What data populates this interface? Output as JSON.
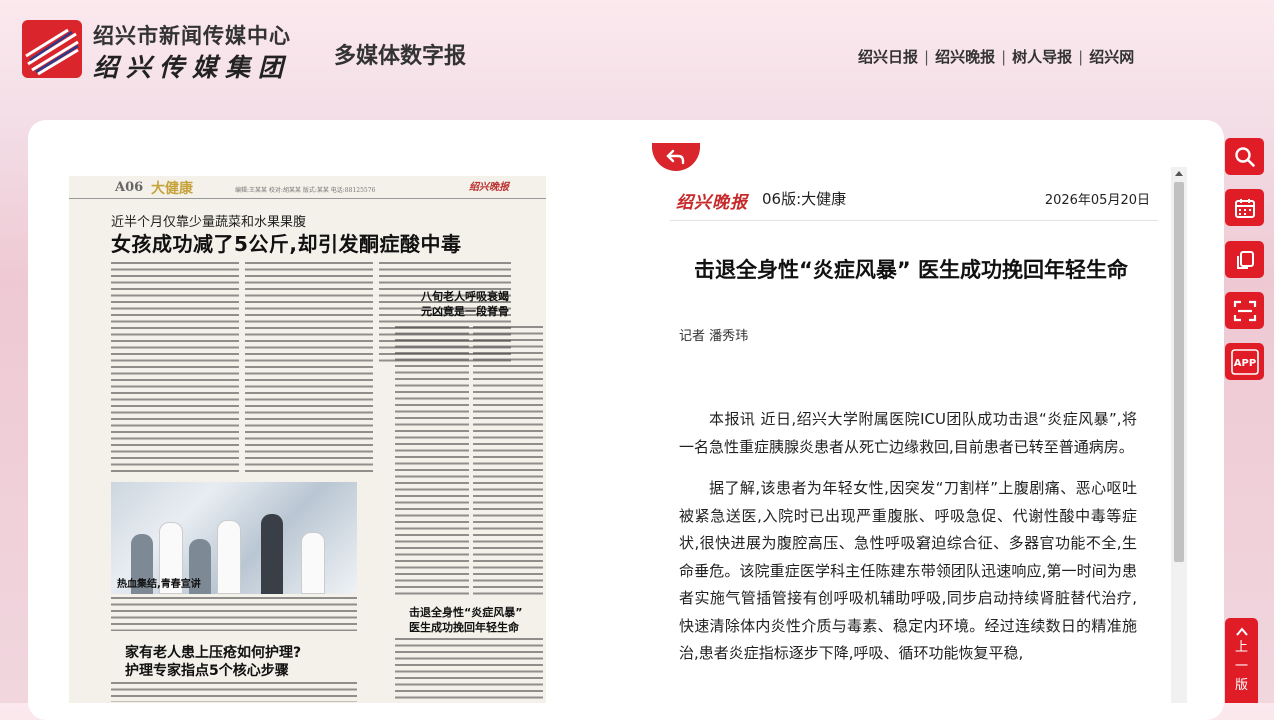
{
  "header": {
    "org_name": "绍兴市新闻传媒中心",
    "org_group": "绍兴传媒集团",
    "site_title": "多媒体数字报",
    "nav": [
      {
        "label": "绍兴日报"
      },
      {
        "label": "绍兴晚报"
      },
      {
        "label": "树人导报"
      },
      {
        "label": "绍兴网"
      }
    ]
  },
  "paper_page": {
    "page_no": "A06",
    "section": "大健康",
    "masthead": "绍兴晚报",
    "header_info": "编辑:王某某 校对:胡某某 版式:某某 电话:88125576",
    "subtitle": "近半个月仅靠少量蔬菜和水果果腹",
    "headline": "女孩成功减了5公斤,却引发酮症酸中毒",
    "story2_title_1": "八旬老人呼吸衰竭",
    "story2_title_2": "元凶竟是一段脊骨",
    "photo_caption": "热血集结,青春宣讲",
    "story3_title_1": "家有老人患上压疮如何护理?",
    "story3_title_2": "护理专家指点5个核心步骤",
    "story4_title_1": "击退全身性“炎症风暴”",
    "story4_title_2": "医生成功挽回年轻生命"
  },
  "article": {
    "paper_logo": "绍兴晚报",
    "edition": "06版:大健康",
    "date": "2026年05月20日",
    "title": "击退全身性“炎症风暴” 医生成功挽回年轻生命",
    "reporter": "记者 潘秀玮",
    "paragraphs": [
      "本报讯 近日,绍兴大学附属医院ICU团队成功击退“炎症风暴”,将一名急性重症胰腺炎患者从死亡边缘救回,目前患者已转至普通病房。",
      "据了解,该患者为年轻女性,因突发“刀割样”上腹剧痛、恶心呕吐被紧急送医,入院时已出现严重腹胀、呼吸急促、代谢性酸中毒等症状,很快进展为腹腔高压、急性呼吸窘迫综合征、多器官功能不全,生命垂危。该院重症医学科主任陈建东带领团队迅速响应,第一时间为患者实施气管插管接有创呼吸机辅助呼吸,同步启动持续肾脏替代治疗,快速清除体内炎性介质与毒素、稳定内环境。经过连续数日的精准施治,患者炎症指标逐步下降,呼吸、循环功能恢复平稳,"
    ]
  },
  "toolbar": {
    "items": [
      {
        "icon": "search-icon"
      },
      {
        "icon": "calendar-icon"
      },
      {
        "icon": "copy-icon"
      },
      {
        "icon": "scan-icon"
      },
      {
        "label": "APP"
      }
    ],
    "prev_page_chars": [
      "上",
      "一",
      "版"
    ]
  },
  "colors": {
    "accent": "#e01c27",
    "masthead_red": "#c62a2a"
  }
}
